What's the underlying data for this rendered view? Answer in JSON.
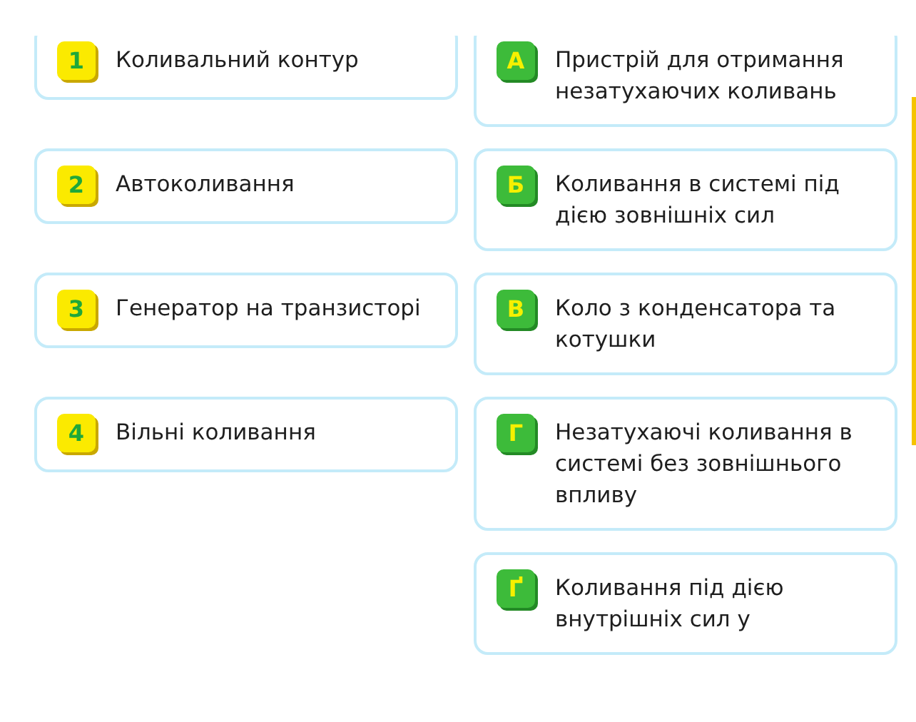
{
  "terms": [
    {
      "badge": "1",
      "text": "Коливальний контур"
    },
    {
      "badge": "2",
      "text": "Автоколивання"
    },
    {
      "badge": "3",
      "text": "Генератор на транзисторі"
    },
    {
      "badge": "4",
      "text": "Вільні коливання"
    }
  ],
  "definitions": [
    {
      "badge": "А",
      "text": "Пристрій для отримання незатухаючих коливань"
    },
    {
      "badge": "Б",
      "text": "Коливання в системі під дією зовнішніх сил"
    },
    {
      "badge": "В",
      "text": "Коло з конденсатора та котушки"
    },
    {
      "badge": "Г",
      "text": "Незатухаючі коливання в системі без зовнішнього впливу"
    },
    {
      "badge": "Ґ",
      "text": "Коливання під дією внутрішніх сил у"
    }
  ]
}
